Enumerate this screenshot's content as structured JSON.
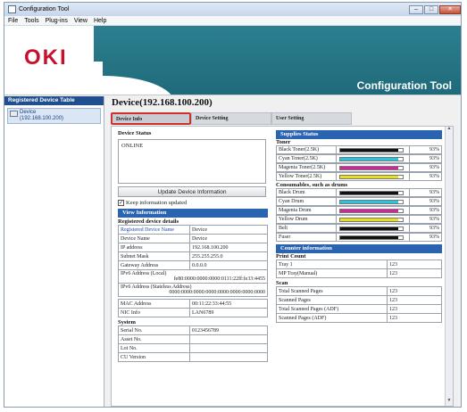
{
  "window": {
    "title": "Configuration Tool"
  },
  "menu": [
    "File",
    "Tools",
    "Plug-ins",
    "View",
    "Help"
  ],
  "banner": {
    "logo": "OKI",
    "app_title": "Configuration Tool"
  },
  "sidebar": {
    "header": "Registered Device Table",
    "device_line1": "Device",
    "device_line2": "(192.168.100.200)"
  },
  "main": {
    "title": "Device(192.168.100.200)",
    "tabs": [
      "Device Info",
      "Device Setting",
      "User Setting"
    ]
  },
  "device_status": {
    "label": "Device Status",
    "value": "ONLINE",
    "update_button": "Update Device Information",
    "keep_updated_label": "Keep information updated",
    "keep_updated_checked": true
  },
  "view_info": {
    "header": "View Information",
    "registered_label": "Registered device details",
    "rows": [
      [
        "Registered Device Name",
        "Device"
      ],
      [
        "Device Name",
        "Device"
      ],
      [
        "IP address",
        "192.168.100.200"
      ],
      [
        "Subnet Mask",
        "255.255.255.0"
      ],
      [
        "Gateway Address",
        "0.0.0.0"
      ]
    ],
    "ipv6_local_label": "IPv6 Address (Local)",
    "ipv6_local_value": "fe80:0000:0000:0000:0111:22ff:fe33:4455",
    "ipv6_stateless_label": "IPv6 Address (Stateless Address)",
    "ipv6_stateless_value": "0000:0000:0000:0000:0000:0000:0000:0000",
    "rows2": [
      [
        "MAC Address",
        "00:11:22:33:44:55"
      ],
      [
        "NIC Info",
        "LAN6789"
      ]
    ],
    "system_label": "System",
    "system_rows": [
      [
        "Serial No.",
        "0123456789"
      ],
      [
        "Asset No.",
        ""
      ],
      [
        "Lot No.",
        ""
      ],
      [
        "CU Version",
        ""
      ]
    ]
  },
  "supplies": {
    "header": "Supplies Status",
    "toner_label": "Toner",
    "toners": [
      {
        "name": "Black Toner(2.5K)",
        "pct": "93%",
        "level": 0.93,
        "color": "#111111"
      },
      {
        "name": "Cyan Toner(2.5K)",
        "pct": "93%",
        "level": 0.93,
        "color": "#28c4e0"
      },
      {
        "name": "Magenta Toner(2.5K)",
        "pct": "93%",
        "level": 0.93,
        "color": "#d4239f"
      },
      {
        "name": "Yellow Toner(2.5K)",
        "pct": "93%",
        "level": 0.93,
        "color": "#e8e01e"
      }
    ],
    "consumables_label": "Consumables, such as drums",
    "consumables": [
      {
        "name": "Black Drum",
        "pct": "93%",
        "level": 0.93,
        "color": "#111111"
      },
      {
        "name": "Cyan Drum",
        "pct": "93%",
        "level": 0.93,
        "color": "#28c4e0"
      },
      {
        "name": "Magenta Drum",
        "pct": "93%",
        "level": 0.93,
        "color": "#d4239f"
      },
      {
        "name": "Yellow Drum",
        "pct": "93%",
        "level": 0.93,
        "color": "#e8e01e"
      },
      {
        "name": "Belt",
        "pct": "93%",
        "level": 0.93,
        "color": "#111111"
      },
      {
        "name": "Fuser",
        "pct": "93%",
        "level": 0.93,
        "color": "#111111"
      }
    ]
  },
  "counter": {
    "header": "Counter information",
    "print_label": "Print Count",
    "print_rows": [
      [
        "Tray 1",
        "123"
      ],
      [
        "MP Tray(Manual)",
        "123"
      ]
    ],
    "scan_label": "Scan",
    "scan_rows": [
      [
        "Total Scanned Pages",
        "123"
      ],
      [
        "Scanned Pages",
        "123"
      ],
      [
        "Total Scanned Pages (ADF)",
        "123"
      ],
      [
        "Scanned Pages (ADF)",
        "123"
      ]
    ]
  }
}
